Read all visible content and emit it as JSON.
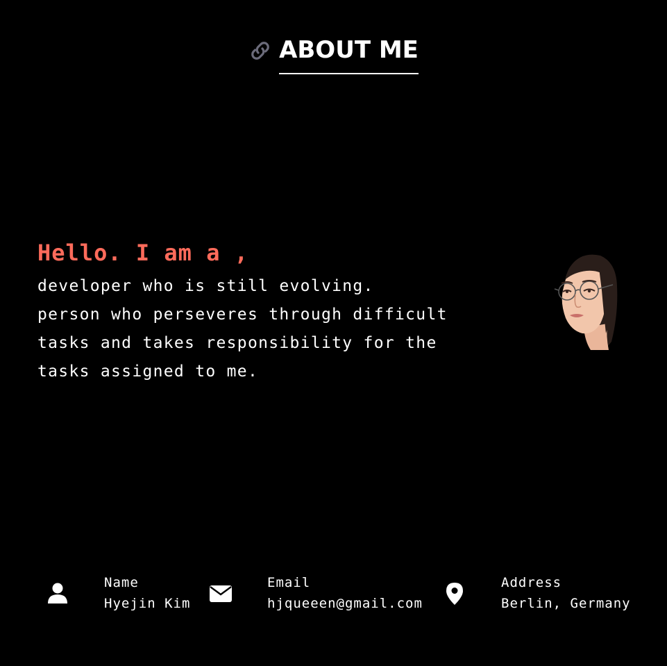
{
  "header": {
    "title": "ABOUT ME",
    "icon": "link-icon"
  },
  "intro": {
    "greeting": "Hello. I am a ,",
    "lines": [
      "developer who is still evolving.",
      "person who perseveres through difficult",
      "tasks and takes responsibility for the",
      "tasks assigned to me."
    ]
  },
  "avatar": {
    "icon": "portrait-illustration"
  },
  "contacts": {
    "name": {
      "label": "Name",
      "value": "Hyejin Kim",
      "icon": "user-icon"
    },
    "email": {
      "label": "Email",
      "value": "hjqueeen@gmail.com",
      "icon": "envelope-icon"
    },
    "address": {
      "label": "Address",
      "value": "Berlin, Germany",
      "icon": "map-pin-icon"
    }
  },
  "colors": {
    "background": "#000000",
    "accent": "#ff6b5b",
    "text": "#ffffff",
    "icon_muted": "#6b6b7a"
  }
}
